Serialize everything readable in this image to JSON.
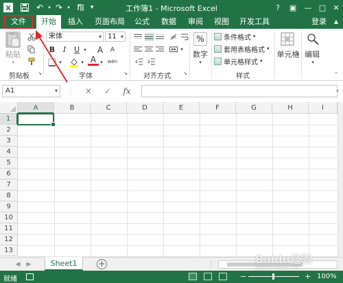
{
  "window": {
    "title": "工作簿1 - Microsoft Excel",
    "help": "?",
    "restore": "▣",
    "minimize": "—",
    "maximize": "□",
    "close": "✕"
  },
  "tabs": [
    {
      "label": "文件"
    },
    {
      "label": "开始"
    },
    {
      "label": "插入"
    },
    {
      "label": "页面布局"
    },
    {
      "label": "公式"
    },
    {
      "label": "数据"
    },
    {
      "label": "审阅"
    },
    {
      "label": "视图"
    },
    {
      "label": "开发工具"
    }
  ],
  "login_label": "登录",
  "ribbon": {
    "clipboard": {
      "label": "剪贴板",
      "paste_label": "粘贴"
    },
    "font": {
      "label": "字体",
      "font_name": "宋体",
      "font_size": "11",
      "bold": "B",
      "italic": "I",
      "underline": "U",
      "grow": "A",
      "shrink": "A",
      "font_color_glyph": "A",
      "pinyin": "wén"
    },
    "alignment": {
      "label": "对齐方式"
    },
    "number": {
      "label": "数字",
      "icon": "%"
    },
    "styles": {
      "label": "样式",
      "conditional": "条件格式",
      "table": "套用表格格式",
      "cell_styles": "单元格样式"
    },
    "cells": {
      "label": "单元格"
    },
    "editing": {
      "label": "编辑"
    }
  },
  "formula_bar": {
    "name_box": "A1",
    "cancel": "✕",
    "enter": "✓",
    "fx": "fx",
    "value": ""
  },
  "grid": {
    "columns": [
      "A",
      "B",
      "C",
      "D",
      "E",
      "F",
      "G",
      "H",
      "I"
    ],
    "rows": [
      "1",
      "2",
      "3",
      "4",
      "5",
      "6",
      "7",
      "8",
      "9",
      "10",
      "11",
      "12",
      "13"
    ]
  },
  "sheets": [
    {
      "label": "Sheet1"
    }
  ],
  "add_sheet": "+",
  "status": {
    "ready": "就绪",
    "zoom": "100%",
    "zoom_in": "+",
    "zoom_out": "−"
  },
  "watermark": {
    "brand": "Baidu经验",
    "url": "jingyan.baidu.com"
  },
  "colors": {
    "accent": "#217346",
    "highlight": "#e1262e"
  }
}
